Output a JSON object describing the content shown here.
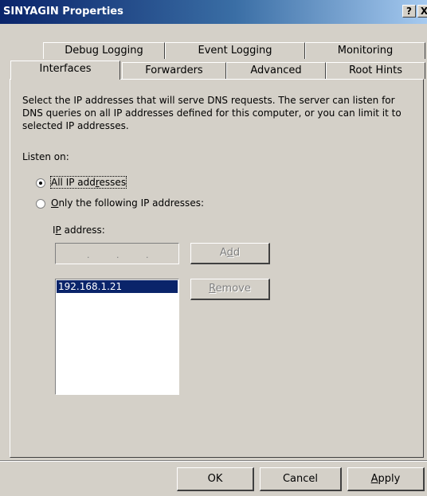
{
  "window": {
    "title": "SINYAGIN Properties",
    "help_label": "?",
    "close_label": "X"
  },
  "tabs_back": [
    {
      "label": "Debug Logging"
    },
    {
      "label": "Event Logging"
    },
    {
      "label": "Monitoring"
    }
  ],
  "tabs_front": [
    {
      "label": "Interfaces"
    },
    {
      "label": "Forwarders"
    },
    {
      "label": "Advanced"
    },
    {
      "label": "Root Hints"
    }
  ],
  "interfaces": {
    "description": "Select the IP addresses that will serve DNS requests. The server can listen for DNS queries on all IP addresses defined for this computer, or you can limit it to selected IP addresses.",
    "listen_on_label": "Listen on:",
    "radio_all": {
      "pre": "All IP add",
      "mnemonic": "r",
      "post": "esses",
      "checked": true
    },
    "radio_only": {
      "pre": "",
      "mnemonic": "O",
      "post": "nly the following IP addresses:",
      "checked": false
    },
    "ip_label": {
      "pre": "I",
      "mnemonic": "P",
      "post": " address:"
    },
    "ip_placeholder_dots": [
      ".",
      ".",
      "."
    ],
    "add_button": {
      "pre": "A",
      "mnemonic": "d",
      "post": "d"
    },
    "remove_button": {
      "pre": "",
      "mnemonic": "R",
      "post": "emove"
    },
    "ip_list": [
      "192.168.1.21"
    ]
  },
  "footer": {
    "ok_label": "OK",
    "cancel_label": "Cancel",
    "apply_button": {
      "pre": "",
      "mnemonic": "A",
      "post": "pply"
    }
  }
}
